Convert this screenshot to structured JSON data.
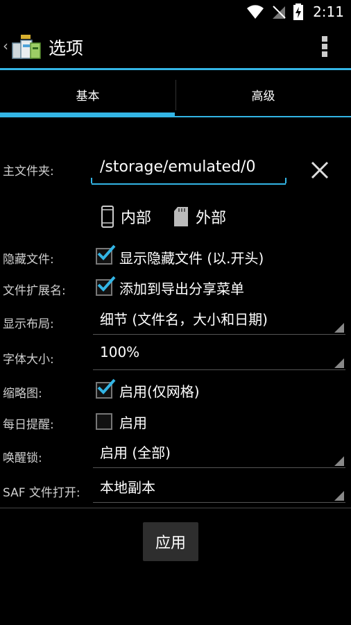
{
  "status": {
    "time": "2:11"
  },
  "action_bar": {
    "title": "选项"
  },
  "tabs": [
    {
      "label": "基本"
    },
    {
      "label": "高级"
    }
  ],
  "home_folder": {
    "label": "主文件夹:",
    "value": "/storage/emulated/0"
  },
  "storage": {
    "internal": "内部",
    "external": "外部"
  },
  "hidden_files": {
    "label": "隐藏文件:",
    "option": "显示隐藏文件 (以.开头)",
    "checked": true
  },
  "file_ext": {
    "label": "文件扩展名:",
    "option": "添加到导出分享菜单",
    "checked": true
  },
  "layout": {
    "label": "显示布局:",
    "value": "细节 (文件名，大小和日期)"
  },
  "font_size": {
    "label": "字体大小:",
    "value": "100%"
  },
  "thumbnails": {
    "label": "缩略图:",
    "option": "启用(仅网格)",
    "checked": true
  },
  "daily_reminder": {
    "label": "每日提醒:",
    "option": "启用",
    "checked": false
  },
  "wake_lock": {
    "label": "唤醒锁:",
    "value": "启用 (全部)"
  },
  "saf": {
    "label": "SAF 文件打开:",
    "value": "本地副本"
  },
  "apply_label": "应用",
  "colors": {
    "accent": "#33b5e5",
    "background": "#000000"
  }
}
